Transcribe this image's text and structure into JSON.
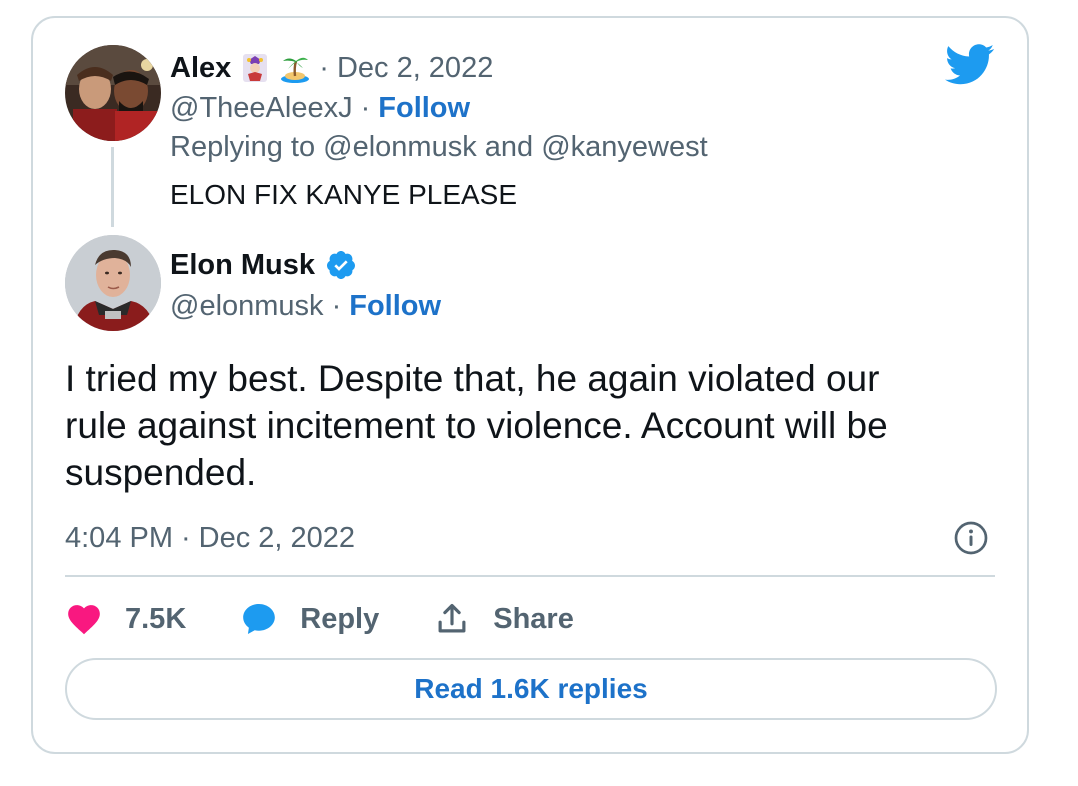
{
  "quoted_tweet": {
    "author_name": "Alex",
    "author_emojis": [
      "jester-emoji",
      "island-emoji"
    ],
    "date": "Dec 2, 2022",
    "handle": "@TheeAleexJ",
    "follow_label": "Follow",
    "replying_prefix": "Replying to",
    "replying_to": [
      "@elonmusk",
      "@kanyewest"
    ],
    "replying_joiner": "and",
    "text": "ELON FIX KANYE PLEASE"
  },
  "main_tweet": {
    "author_name": "Elon Musk",
    "verified": true,
    "handle": "@elonmusk",
    "follow_label": "Follow",
    "text": "I tried my best. Despite that, he again violated our\nrule against incitement to violence. Account will be\nsuspended.",
    "time": "4:04 PM",
    "date": "Dec 2, 2022"
  },
  "separator": "·",
  "actions": {
    "like_count": "7.5K",
    "reply_label": "Reply",
    "share_label": "Share"
  },
  "read_replies_label": "Read 1.6K replies",
  "colors": {
    "accent": "#1d72c9",
    "twitter_blue": "#1d9bf0",
    "like_pink": "#f91880",
    "muted": "#536471",
    "border": "#cfd9de"
  },
  "icons": [
    "twitter-bird-icon",
    "verified-badge-icon",
    "info-icon",
    "heart-icon",
    "reply-bubble-icon",
    "share-icon"
  ]
}
